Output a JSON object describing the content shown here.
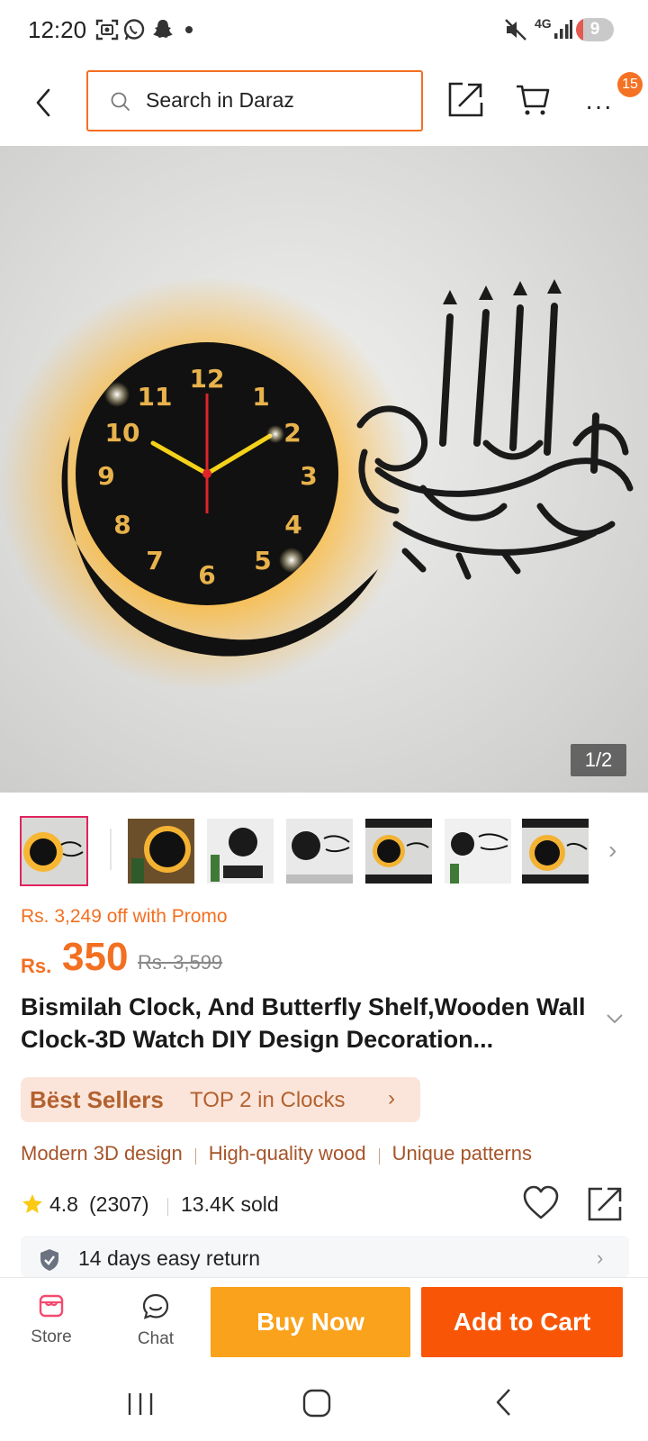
{
  "status_bar": {
    "time": "12:20",
    "network": "4G",
    "battery": "9",
    "icons": [
      "screen-capture-icon",
      "whatsapp-icon",
      "snapchat-icon",
      "dot-icon",
      "mute-icon",
      "signal-icon",
      "battery-icon"
    ]
  },
  "top_bar": {
    "search_placeholder": "Search in Daraz",
    "cart_badge": "15"
  },
  "gallery": {
    "counter": "1/2",
    "thumbnail_count": 7
  },
  "price": {
    "promo": "Rs. 3,249 off with Promo",
    "currency": "Rs.",
    "current": "350",
    "original": "Rs. 3,599"
  },
  "product": {
    "title": "Bismilah Clock, And Butterfly Shelf,Wooden Wall Clock-3D Watch DIY Design Decoration..."
  },
  "best_seller": {
    "label": "Bëst Sellers",
    "rank": "TOP 2 in Clocks"
  },
  "features": [
    "Modern 3D design",
    "High-quality wood",
    "Unique patterns"
  ],
  "rating": {
    "score": "4.8",
    "count": "(2307)",
    "sold": "13.4K sold"
  },
  "service": {
    "return_text": "14 days easy return"
  },
  "action_bar": {
    "store_label": "Store",
    "chat_label": "Chat",
    "buy_now_label": "Buy Now",
    "add_to_cart_label": "Add to Cart"
  },
  "colors": {
    "accent": "#f36f21",
    "buy_now": "#faa21b",
    "add_to_cart": "#f85606",
    "best_seller_bg": "#fbe5da",
    "best_seller_text": "#b3612f",
    "feature_text": "#a65428",
    "thumb_active_border": "#e0245e"
  }
}
